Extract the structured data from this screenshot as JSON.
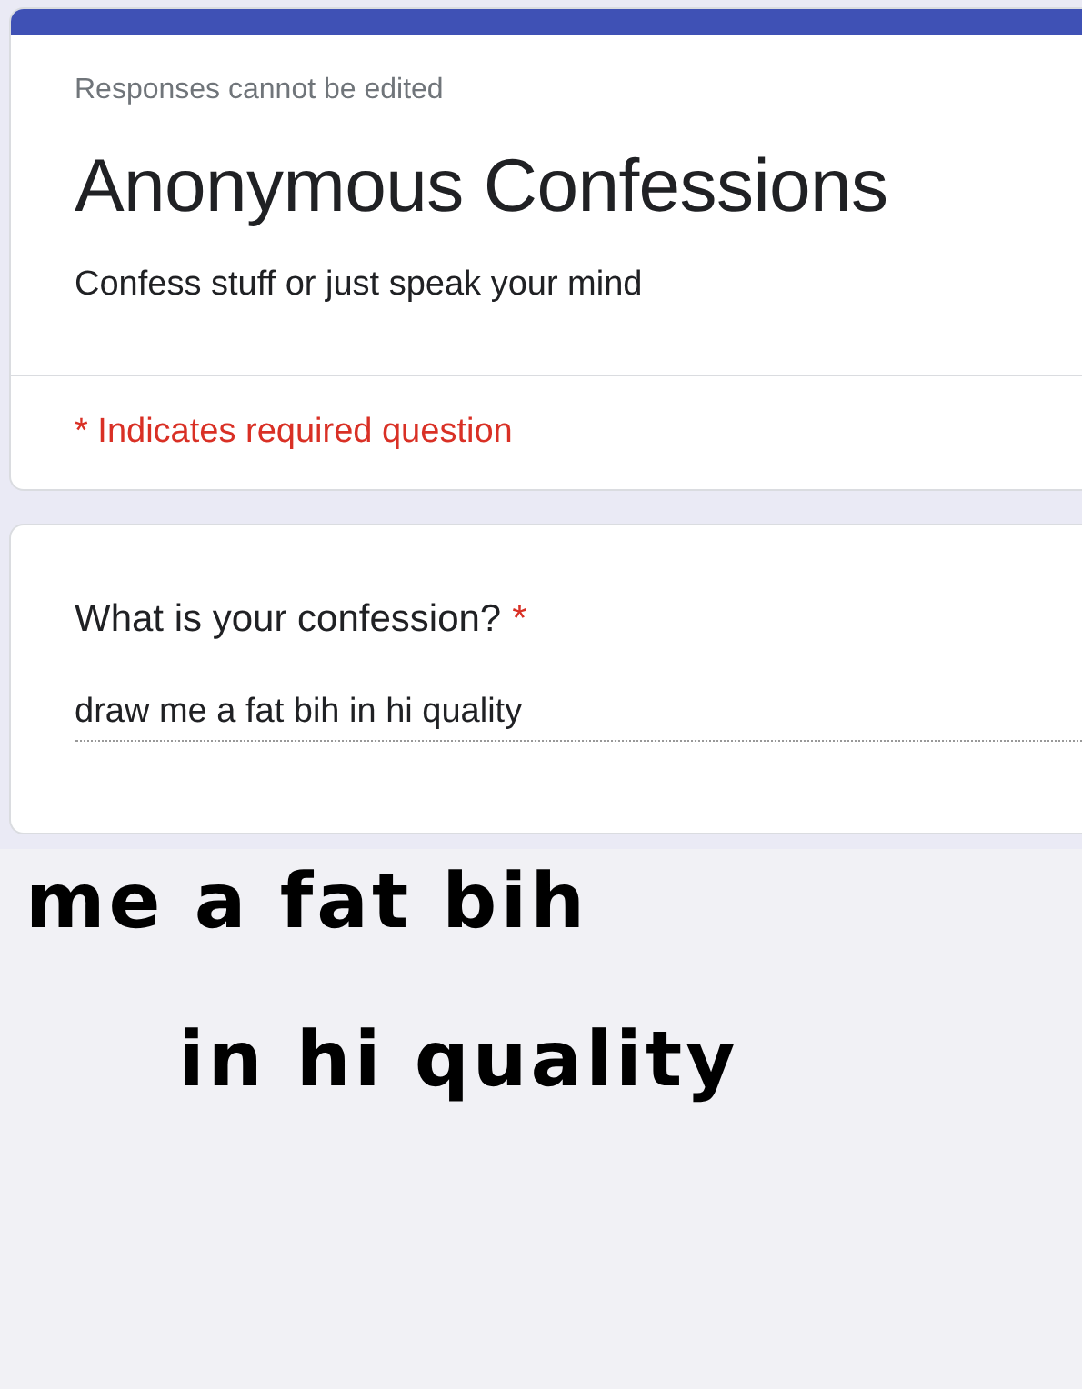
{
  "header_card": {
    "notice": "Responses cannot be edited",
    "title": "Anonymous Confessions",
    "description": "Confess stuff or just speak your mind",
    "required_note": "* Indicates required question"
  },
  "question": {
    "label": "What is your confession?",
    "required": true,
    "required_mark": "*",
    "value": "draw me a fat bih in hi quality"
  },
  "handwriting": [
    "me a fat bih",
    "in hi quality"
  ]
}
